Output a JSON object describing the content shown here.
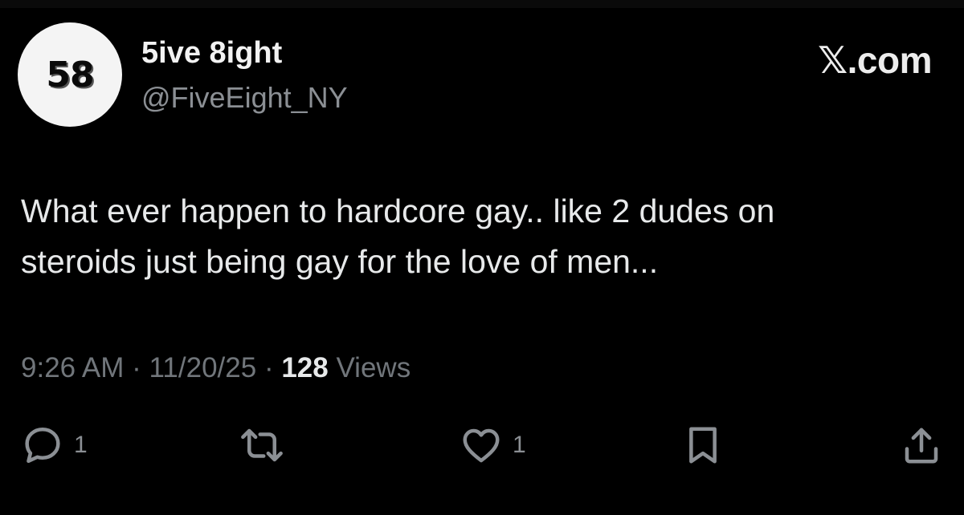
{
  "author": {
    "avatar_text": "58",
    "display_name": "5ive 8ight",
    "handle": "@FiveEight_NY"
  },
  "site_badge": "𝕏.com",
  "tweet": {
    "lines": [
      "What ever happen to hardcore gay.. like 2 dudes on",
      "steroids just being gay for the love of men..."
    ]
  },
  "meta": {
    "time": "9:26 AM",
    "separator": "·",
    "date": "11/20/25",
    "views_count": "128",
    "views_label": "Views"
  },
  "actions": {
    "reply": {
      "icon": "reply-icon",
      "count": "1"
    },
    "repost": {
      "icon": "repost-icon"
    },
    "like": {
      "icon": "heart-icon",
      "count": "1"
    },
    "bookmark": {
      "icon": "bookmark-icon"
    },
    "share": {
      "icon": "share-icon"
    }
  },
  "colors": {
    "background": "#000000",
    "text_primary": "#e7e9ea",
    "text_secondary": "#71767b",
    "avatar_bg": "#f4f4f4"
  }
}
